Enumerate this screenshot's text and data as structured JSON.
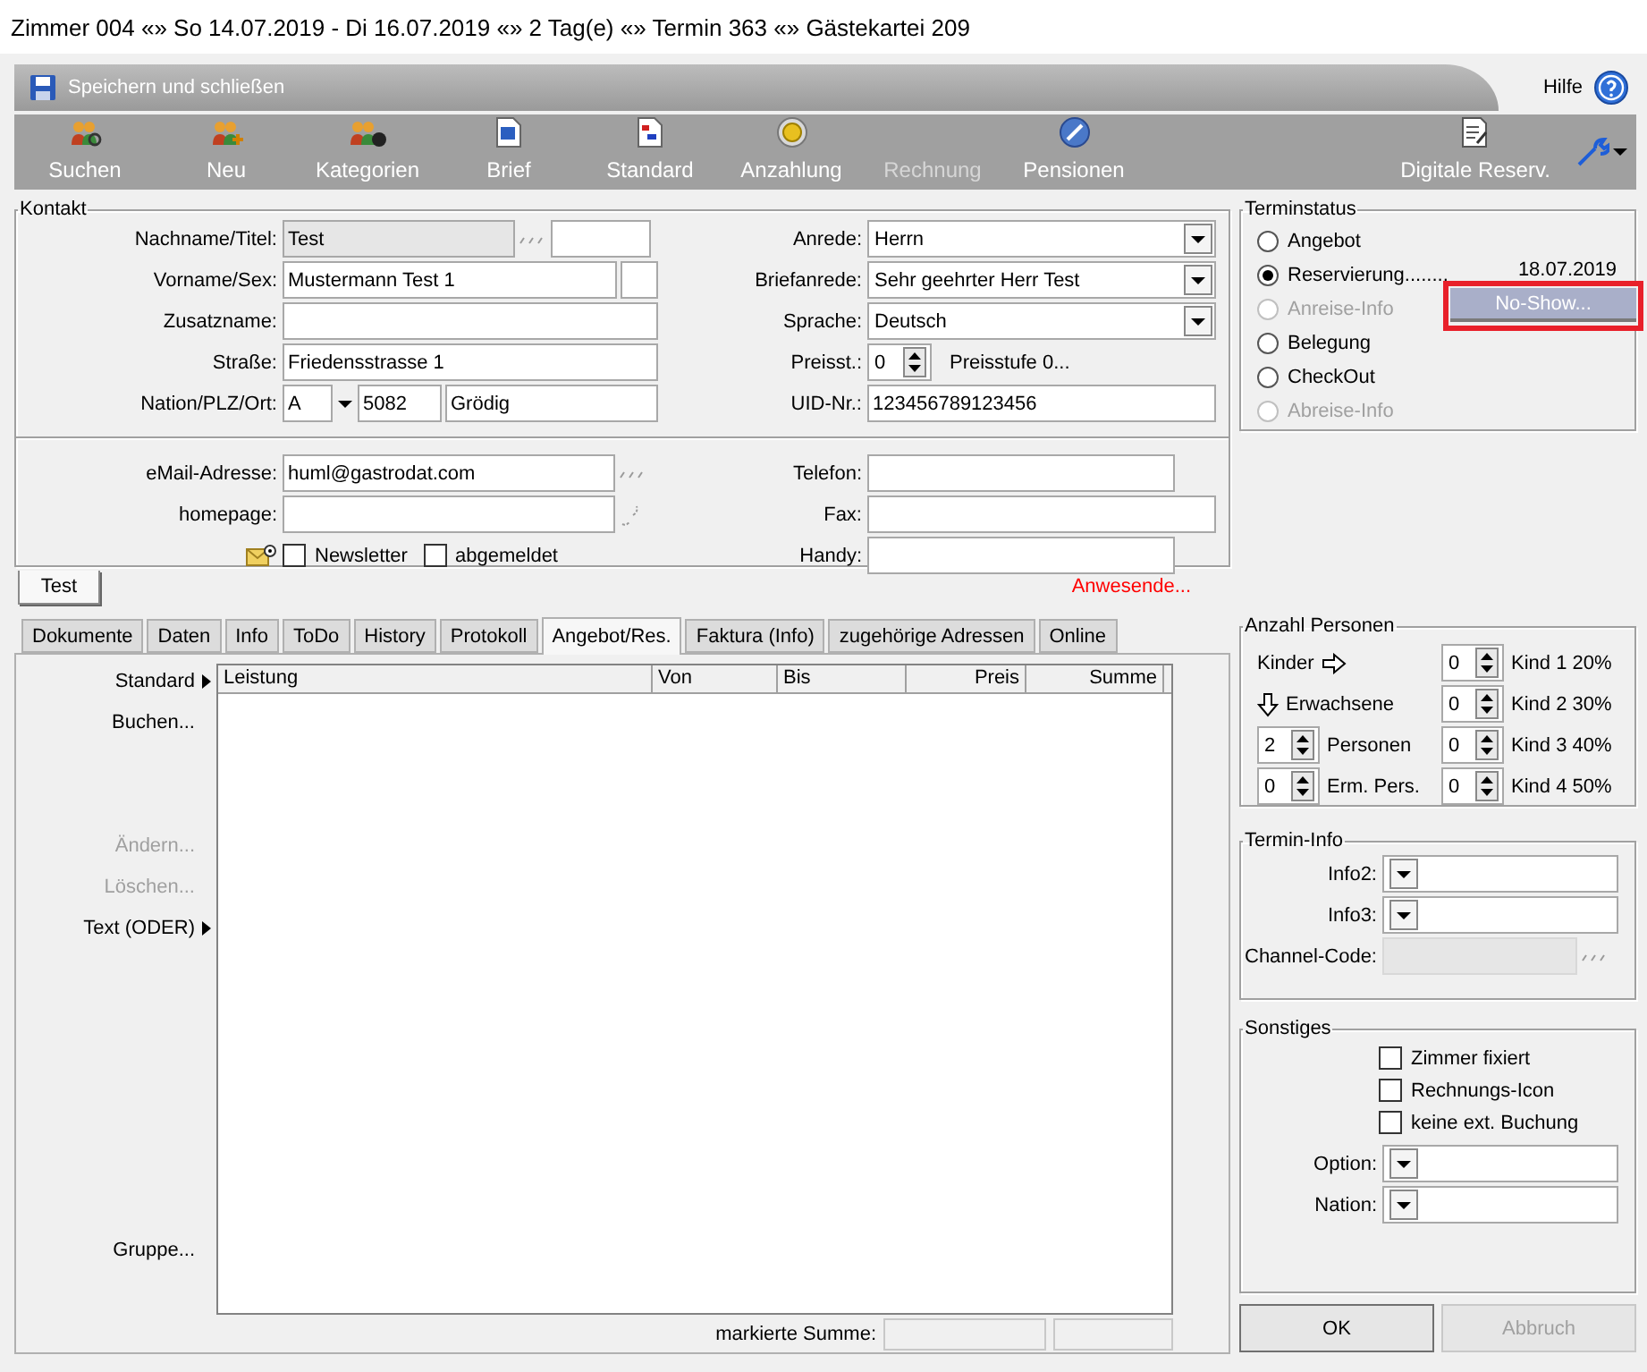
{
  "window": {
    "title": "Zimmer 004 «» So 14.07.2019 - Di 16.07.2019 «» 2 Tag(e) «» Termin 363 «» Gästekartei 209"
  },
  "header": {
    "save_label": "Speichern und schließen",
    "help_label": "Hilfe"
  },
  "toolbar": [
    {
      "label": "Suchen",
      "kind": "people-search",
      "disabled": false
    },
    {
      "label": "Neu",
      "kind": "people-add",
      "disabled": false
    },
    {
      "label": "Kategorien",
      "kind": "people-group",
      "disabled": false
    },
    {
      "label": "Brief",
      "kind": "letter",
      "disabled": false
    },
    {
      "label": "Standard",
      "kind": "document",
      "disabled": false
    },
    {
      "label": "Anzahlung",
      "kind": "coin",
      "disabled": false
    },
    {
      "label": "Rechnung",
      "kind": "plain",
      "disabled": true
    },
    {
      "label": "Pensionen",
      "kind": "disc",
      "disabled": false
    }
  ],
  "toolbar_right": [
    {
      "label": "Digitale Reserv.",
      "kind": "clipboard",
      "disabled": false
    }
  ],
  "kontakt": {
    "title": "Kontakt",
    "nachname": {
      "label": "Nachname/Titel:",
      "value": "Test",
      "readonly": true
    },
    "vorname": {
      "label": "Vorname/Sex:",
      "value": "Mustermann Test 1"
    },
    "zusatzname": {
      "label": "Zusatzname:"
    },
    "strasse": {
      "label": "Straße:",
      "value": "Friedensstrasse 1"
    },
    "ort": {
      "label": "Nation/PLZ/Ort:",
      "nation": "A",
      "plz": "5082",
      "ort": "Grödig"
    },
    "anrede": {
      "label": "Anrede:",
      "value": "Herrn"
    },
    "briefanrede": {
      "label": "Briefanrede:",
      "value": "Sehr geehrter Herr Test"
    },
    "sprache": {
      "label": "Sprache:",
      "value": "Deutsch"
    },
    "preisstufe": {
      "label": "Preisst.:",
      "value": "0",
      "text": "Preisstufe 0..."
    },
    "uid": {
      "label": "UID-Nr.:",
      "value": "123456789123456"
    },
    "email": {
      "label": "eMail-Adresse:",
      "value": "huml@gastrodat.com"
    },
    "homepage": {
      "label": "homepage:"
    },
    "telefon": {
      "label": "Telefon:"
    },
    "fax": {
      "label": "Fax:"
    },
    "handy": {
      "label": "Handy:"
    },
    "checks": [
      {
        "label": "Newsletter",
        "checked": false
      },
      {
        "label": "abgemeldet",
        "checked": false
      }
    ]
  },
  "subtab": {
    "label": "Test",
    "selected": true
  },
  "anwesende": "Anwesende...",
  "tabs": [
    {
      "label": "Dokumente",
      "selected": false
    },
    {
      "label": "Daten",
      "selected": false
    },
    {
      "label": "Info",
      "selected": false
    },
    {
      "label": "ToDo",
      "selected": false
    },
    {
      "label": "History",
      "selected": false
    },
    {
      "label": "Protokoll",
      "selected": false
    },
    {
      "label": "Angebot/Res.",
      "selected": true
    },
    {
      "label": "Faktura (Info)",
      "selected": false
    },
    {
      "label": "zugehörige Adressen",
      "selected": false
    },
    {
      "label": "Online",
      "selected": false
    }
  ],
  "side_actions": [
    {
      "label": "Standard",
      "submenu": true,
      "disabled": false
    },
    {
      "label": "Buchen...",
      "submenu": false,
      "disabled": false
    },
    {
      "label": "Ändern...",
      "submenu": false,
      "disabled": true
    },
    {
      "label": "Löschen...",
      "submenu": false,
      "disabled": true
    },
    {
      "label": "Text (ODER)",
      "submenu": true,
      "disabled": false
    },
    {
      "label": "Gruppe...",
      "submenu": false,
      "disabled": false
    }
  ],
  "table": {
    "columns": [
      {
        "label": "Leistung",
        "numeric": false
      },
      {
        "label": "Von",
        "numeric": false
      },
      {
        "label": "Bis",
        "numeric": false
      },
      {
        "label": "Preis",
        "numeric": true
      },
      {
        "label": "Summe",
        "numeric": true
      }
    ]
  },
  "summary": {
    "label": "markierte Summe:"
  },
  "terminstatus": {
    "title": "Terminstatus",
    "options": [
      {
        "label": "Angebot",
        "selected": false,
        "disabled": false
      },
      {
        "label": "Reservierung........",
        "selected": true,
        "disabled": false,
        "date": "18.07.2019"
      },
      {
        "label": "Anreise-Info",
        "selected": false,
        "disabled": true
      },
      {
        "label": "Belegung",
        "selected": false,
        "disabled": false
      },
      {
        "label": "CheckOut",
        "selected": false,
        "disabled": false
      },
      {
        "label": "Abreise-Info",
        "selected": false,
        "disabled": true
      }
    ]
  },
  "popup_menu": {
    "items": [
      "No-Show..."
    ]
  },
  "personen": {
    "title": "Anzahl Personen",
    "kinder_label": "Kinder",
    "erwachsene_label": "Erwachsene",
    "counts": [
      {
        "value": "2",
        "label": "Personen"
      },
      {
        "value": "0",
        "label": "Erm. Pers."
      }
    ],
    "kinder": [
      {
        "value": "0",
        "label": "Kind 1 20%"
      },
      {
        "value": "0",
        "label": "Kind 2 30%"
      },
      {
        "value": "0",
        "label": "Kind 3 40%"
      },
      {
        "value": "0",
        "label": "Kind 4 50%"
      }
    ]
  },
  "termin_info": {
    "title": "Termin-Info",
    "fields": [
      {
        "kind": "combo",
        "label": "Info2:"
      },
      {
        "kind": "combo",
        "label": "Info3:"
      },
      {
        "kind": "text",
        "label": "Channel-Code:",
        "disabled": true
      }
    ]
  },
  "sonstiges": {
    "title": "Sonstiges",
    "checks": [
      {
        "label": "Zimmer fixiert",
        "checked": false
      },
      {
        "label": "Rechnungs-Icon",
        "checked": false
      },
      {
        "label": "keine ext. Buchung",
        "checked": false
      }
    ],
    "combos": [
      {
        "label": "Option:"
      },
      {
        "label": "Nation:"
      }
    ]
  },
  "buttons": [
    {
      "label": "OK",
      "disabled": false
    },
    {
      "label": "Abbruch",
      "disabled": true
    }
  ]
}
